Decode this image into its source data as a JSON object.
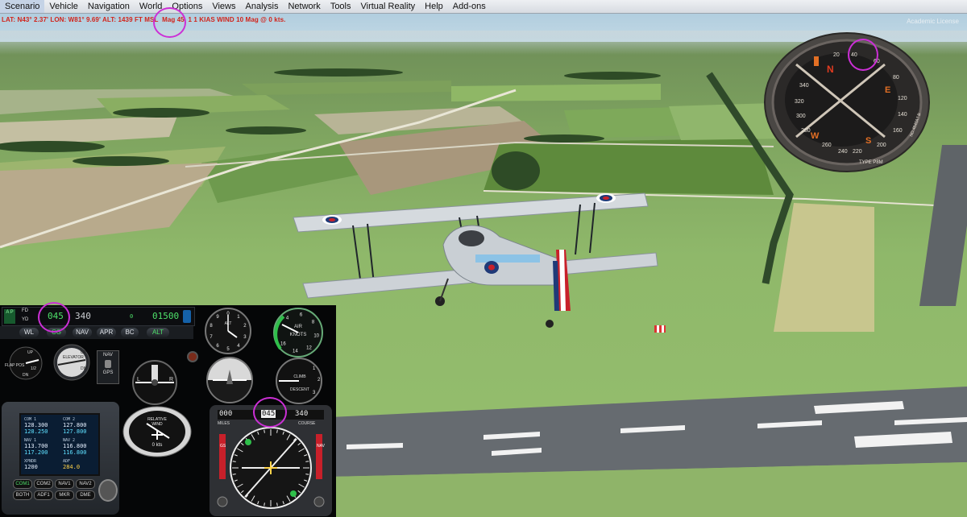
{
  "menu": [
    "Scenario",
    "Vehicle",
    "Navigation",
    "World",
    "Options",
    "Views",
    "Analysis",
    "Network",
    "Tools",
    "Virtual Reality",
    "Help",
    "Add-ons"
  ],
  "status": {
    "text_a": "LAT: N43° 2.37'  LON: W81° 9.69'  ALT: 1439 FT  MSL",
    "text_b": "Mag 45",
    "text_c": "1 1 KIAS  WIND 10 Mag @ 0 kts."
  },
  "license": "Academic License",
  "compass": {
    "labels": [
      "N",
      "E",
      "S",
      "W"
    ],
    "numbers": [
      "40",
      "60",
      "80",
      "20",
      "340",
      "320",
      "300",
      "280",
      "260",
      "240",
      "220",
      "200",
      "160",
      "140",
      "120"
    ],
    "brand_text": "TYPE  P8M",
    "serial": "NO.4840A7 B"
  },
  "autopilot": {
    "ap_label": "A P",
    "fd_label": "FD",
    "yd_label": "YD",
    "heading": "045",
    "course": "340",
    "vs": "0",
    "altitude": "01500",
    "buttons": [
      "WL",
      "CG",
      "NAV",
      "APR",
      "BC",
      "ALT"
    ]
  },
  "flaps": {
    "label": "FLAP POS",
    "marks": [
      "UP",
      "1/2",
      "DN"
    ]
  },
  "elevator": {
    "label": "ELEVATOR",
    "marks": [
      "DN",
      "UP"
    ]
  },
  "nav_gps": {
    "top": "NAV",
    "bottom": "GPS"
  },
  "alt_gauge": {
    "label": "ALT",
    "nums": [
      "0",
      "1",
      "2",
      "3",
      "4",
      "5",
      "6",
      "7",
      "8",
      "9"
    ]
  },
  "airspeed": {
    "label_a": "AIR",
    "label_b": "KNOTS",
    "nums": [
      "4",
      "6",
      "8",
      "10",
      "12",
      "14",
      "16"
    ]
  },
  "vsi": {
    "label_a": "CLIMB",
    "label_b": "DESCENT",
    "nums": [
      "1",
      "2",
      "3"
    ]
  },
  "turn": {
    "left": "L",
    "right": "R"
  },
  "radio": {
    "rows": [
      {
        "l_label": "COM 1",
        "l_val": "128.300",
        "l_sb": "128.250",
        "r_label": "COM 2",
        "r_val": "127.800",
        "r_sb": "127.800"
      },
      {
        "l_label": "NAV 1",
        "l_val": "113.700",
        "l_sb": "117.200",
        "r_label": "NAV 2",
        "r_val": "116.800",
        "r_sb": "116.800"
      },
      {
        "l_label": "XPNDR",
        "l_val": "1200",
        "l_sb": "",
        "r_label": "ADF",
        "r_val": "284.0",
        "r_sb": ""
      }
    ],
    "buttons": [
      "COM1",
      "COM2",
      "NAV1",
      "NAV2",
      "BOTH",
      "ADF1",
      "MKR",
      "DME"
    ]
  },
  "rmi": {
    "line1": "RELATIVE",
    "line2": "WIND",
    "kts": "0 kts"
  },
  "hsi": {
    "miles": "000",
    "heading": "045",
    "course": "340",
    "miles_label": "MILES",
    "course_label": "COURSE",
    "gs": "GS",
    "nav": "NAV"
  },
  "colors": {
    "highlight": "#cc2fd6",
    "status": "#d2231a",
    "ap_green": "#4ee06a"
  }
}
